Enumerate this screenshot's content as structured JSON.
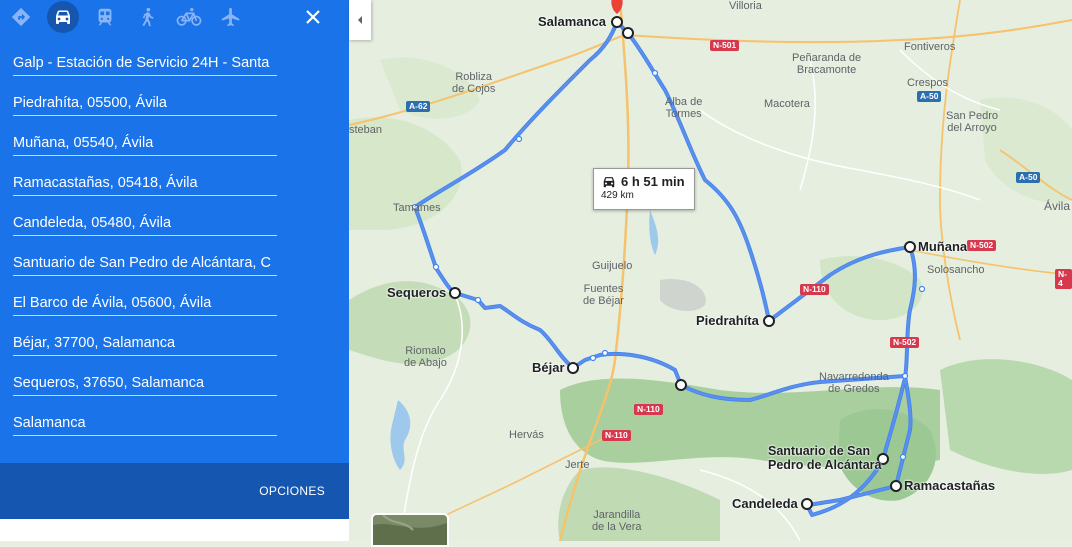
{
  "travel_modes": [
    {
      "name": "best-route",
      "icon": "directions-icon",
      "active": false
    },
    {
      "name": "driving",
      "icon": "car-icon",
      "active": true
    },
    {
      "name": "transit",
      "icon": "train-icon",
      "active": false
    },
    {
      "name": "walking",
      "icon": "walking-icon",
      "active": false
    },
    {
      "name": "cycling",
      "icon": "bicycle-icon",
      "active": false
    },
    {
      "name": "flights",
      "icon": "airplane-icon",
      "active": false
    }
  ],
  "stops": [
    "Galp - Estación de Servicio 24H - Santa",
    "Piedrahíta, 05500, Ávila",
    "Muñana, 05540, Ávila",
    "Ramacastañas, 05418, Ávila",
    "Candeleda, 05480, Ávila",
    "Santuario de San Pedro de Alcántara, C",
    "El Barco de Ávila, 05600, Ávila",
    "Béjar, 37700, Salamanca",
    "Sequeros, 37650, Salamanca",
    "Salamanca"
  ],
  "options_label": "OPCIONES",
  "route": {
    "time": "6 h 51 min",
    "distance": "429 km"
  },
  "map": {
    "cities": {
      "salamanca": "Salamanca",
      "munana": "Muñana",
      "sequeros": "Sequeros",
      "piedrahita": "Piedrahíta",
      "bejar": "Béjar",
      "santuario_1": "Santuario de San",
      "santuario_2": "Pedro de Alcántara",
      "ramacastanas": "Ramacastañas",
      "candeleda": "Candeleda"
    },
    "places": {
      "villoria": "Villoria",
      "fontiveros": "Fontiveros",
      "penaranda_1": "Peñaranda de",
      "penaranda_2": "Bracamonte",
      "robliza_1": "Robliza",
      "robliza_2": "de Cojos",
      "alba_1": "Alba de",
      "alba_2": "Tormes",
      "macotera": "Macotera",
      "crespos": "Crespos",
      "san_pedro_1": "San Pedro",
      "san_pedro_2": "del Arroyo",
      "esteban": "steban",
      "avila": "Ávila",
      "tamames": "Tamames",
      "guijuelo": "Guijuelo",
      "fuentes_1": "Fuentes",
      "fuentes_2": "de Béjar",
      "solosancho": "Solosancho",
      "riomalo_1": "Riomalo",
      "riomalo_2": "de Abajo",
      "navarredonda_1": "Navarredonda",
      "navarredonda_2": "de Gredos",
      "hervas": "Hervás",
      "jerte": "Jerte",
      "jarandilla_1": "Jarandilla",
      "jarandilla_2": "de la Vera"
    },
    "roads": {
      "n501": "N-501",
      "a62": "A-62",
      "a50_1": "A-50",
      "a50_2": "A-50",
      "n502_1": "N-502",
      "n502_2": "N-502",
      "n110_1": "N-110",
      "n110_2": "N-110",
      "n110_3": "N-110",
      "n4": "N-4"
    }
  }
}
